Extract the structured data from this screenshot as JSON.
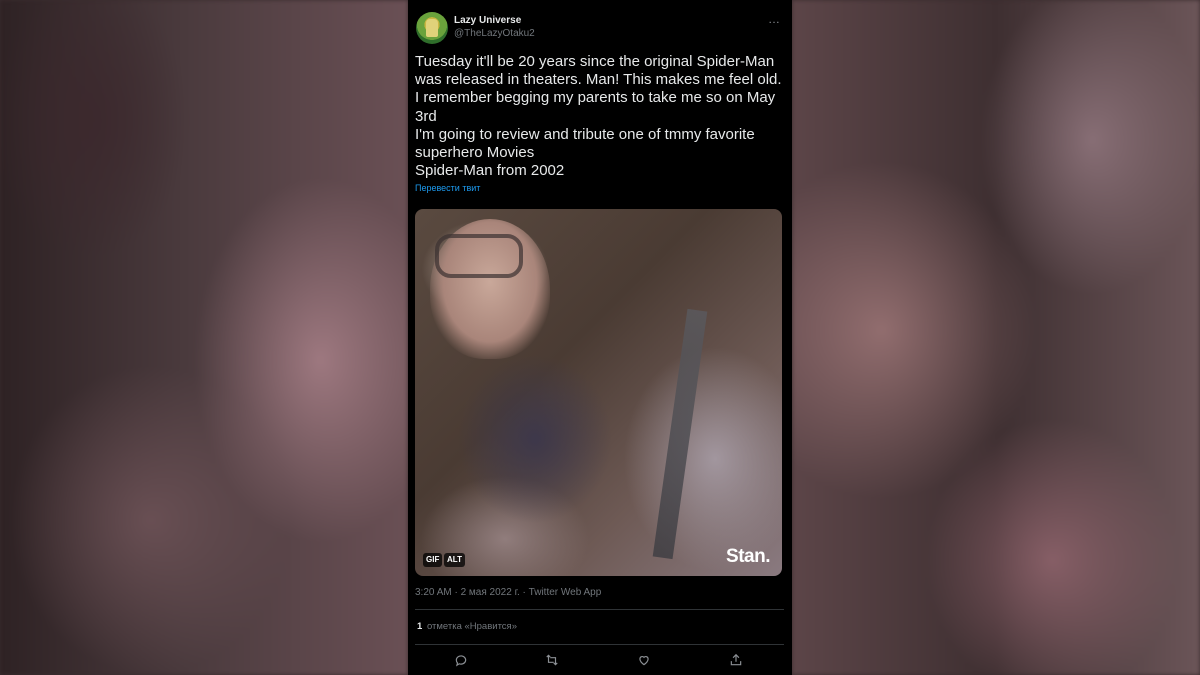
{
  "tweet": {
    "author_name": "Lazy Universe",
    "author_handle": "@TheLazyOtaku2",
    "more_icon": "…",
    "text": "Tuesday it'll be 20 years since the original Spider-Man\nwas released in theaters. Man! This makes me feel old.\nI remember begging my parents to take me so on May\n3rd\nI'm going to review and tribute one of tmmy favorite\nsuperhero Movies\nSpider-Man from 2002",
    "translate_link": "Перевести твит",
    "media": {
      "gif_badge": "GIF",
      "alt_badge": "ALT",
      "watermark": "Stan."
    },
    "meta": "3:20 AM · 2 мая 2022 г. · Twitter Web App",
    "likes_count": "1",
    "likes_label": "отметка «Нравится»",
    "actions": [
      "reply-icon",
      "retweet-icon",
      "like-icon",
      "share-icon"
    ]
  },
  "colors": {
    "background": "#000000",
    "text": "#e7e9ea",
    "secondary": "#71767b",
    "link": "#1d9bf0",
    "divider": "#2f3336"
  }
}
